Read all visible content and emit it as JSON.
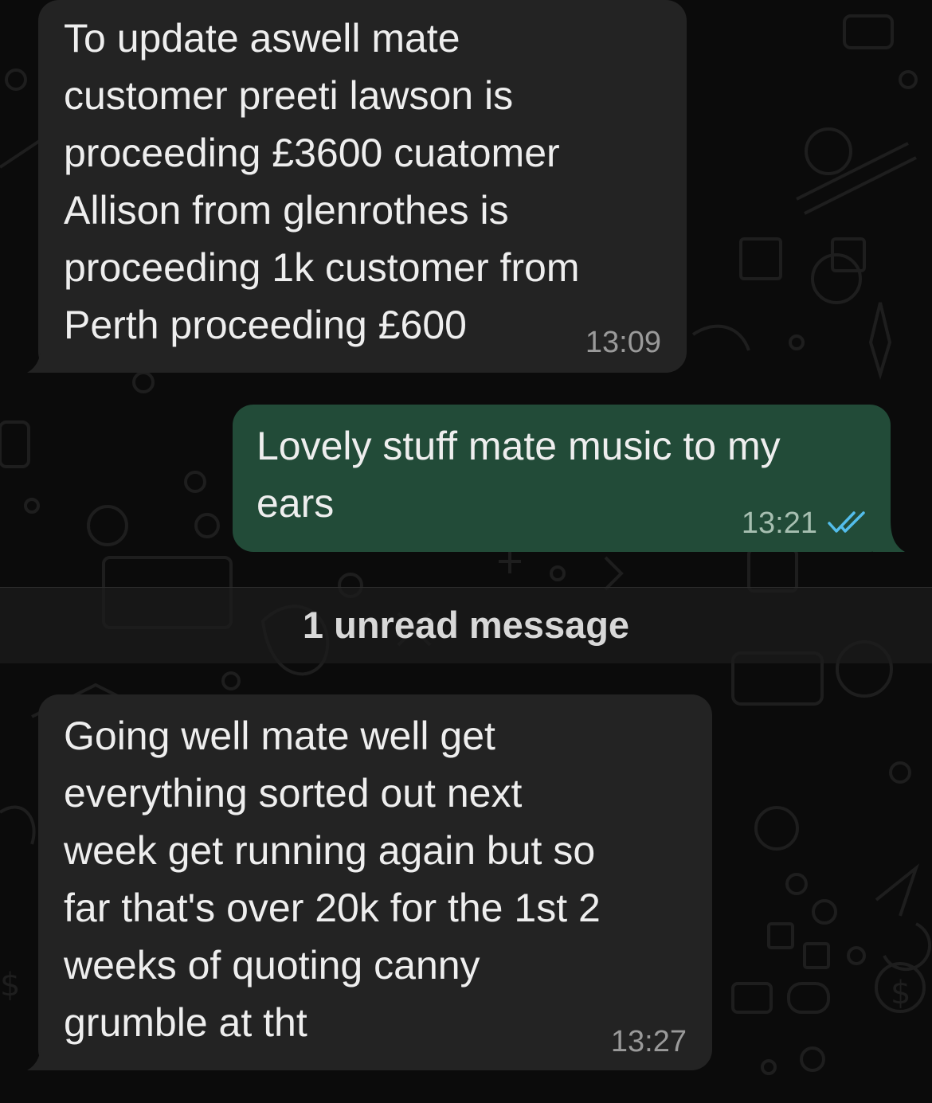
{
  "theme": {
    "background": "#0b0b0b",
    "doodle_color": "#1f1f1f",
    "incoming_bubble": "#232323",
    "outgoing_bubble": "#224b38",
    "read_tick_color": "#53bdeb"
  },
  "messages": [
    {
      "direction": "incoming",
      "text": "To update aswell mate\ncustomer preeti lawson is\nproceeding £3600 cuatomer\nAllison from glenrothes is\nproceeding 1k customer from\nPerth proceeding £600",
      "time": "13:09"
    },
    {
      "direction": "outgoing",
      "text": "Lovely stuff mate music to my\nears",
      "time": "13:21",
      "status_icon": "double-check-read-icon"
    },
    {
      "direction": "incoming",
      "text": "Going well mate well get\neverything sorted out next\nweek get running again but so\nfar that's over 20k for the 1st 2\nweeks of quoting canny\ngrumble at tht",
      "time": "13:27"
    }
  ],
  "unread_divider": {
    "label": "1 unread message"
  }
}
